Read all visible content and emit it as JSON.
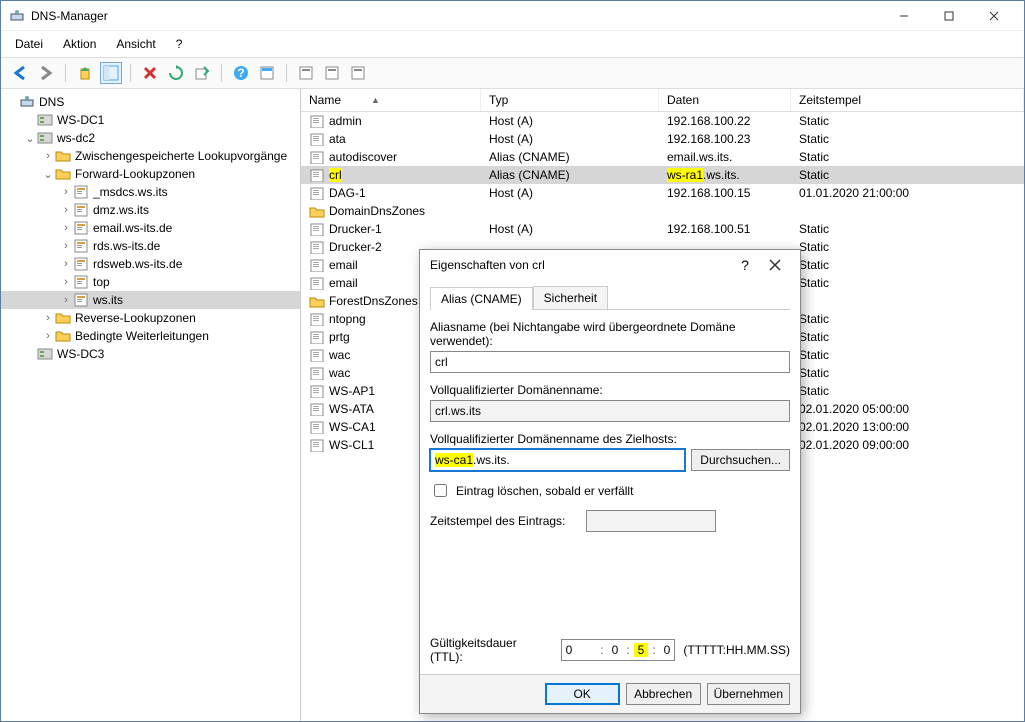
{
  "window": {
    "title": "DNS-Manager"
  },
  "menu": {
    "datei": "Datei",
    "aktion": "Aktion",
    "ansicht": "Ansicht",
    "help": "?"
  },
  "tree": {
    "root": "DNS",
    "nodes": [
      {
        "label": "WS-DC1",
        "depth": 1,
        "exp": "",
        "icon": "server"
      },
      {
        "label": "ws-dc2",
        "depth": 1,
        "exp": "v",
        "icon": "server"
      },
      {
        "label": "Zwischengespeicherte Lookupvorgänge",
        "depth": 2,
        "exp": ">",
        "icon": "folder"
      },
      {
        "label": "Forward-Lookupzonen",
        "depth": 2,
        "exp": "v",
        "icon": "folder"
      },
      {
        "label": "_msdcs.ws.its",
        "depth": 3,
        "exp": ">",
        "icon": "zone"
      },
      {
        "label": "dmz.ws.its",
        "depth": 3,
        "exp": ">",
        "icon": "zone"
      },
      {
        "label": "email.ws-its.de",
        "depth": 3,
        "exp": ">",
        "icon": "zone"
      },
      {
        "label": "rds.ws-its.de",
        "depth": 3,
        "exp": ">",
        "icon": "zone"
      },
      {
        "label": "rdsweb.ws-its.de",
        "depth": 3,
        "exp": ">",
        "icon": "zone"
      },
      {
        "label": "top",
        "depth": 3,
        "exp": ">",
        "icon": "zone"
      },
      {
        "label": "ws.its",
        "depth": 3,
        "exp": ">",
        "icon": "zone",
        "sel": true
      },
      {
        "label": "Reverse-Lookupzonen",
        "depth": 2,
        "exp": ">",
        "icon": "folder"
      },
      {
        "label": "Bedingte Weiterleitungen",
        "depth": 2,
        "exp": ">",
        "icon": "folder"
      },
      {
        "label": "WS-DC3",
        "depth": 1,
        "exp": "",
        "icon": "server"
      }
    ]
  },
  "list": {
    "headers": {
      "name": "Name",
      "typ": "Typ",
      "daten": "Daten",
      "zs": "Zeitstempel"
    },
    "rows": [
      {
        "name": "admin",
        "typ": "Host (A)",
        "daten": "192.168.100.22",
        "zs": "Static",
        "icon": "rec"
      },
      {
        "name": "ata",
        "typ": "Host (A)",
        "daten": "192.168.100.23",
        "zs": "Static",
        "icon": "rec"
      },
      {
        "name": "autodiscover",
        "typ": "Alias (CNAME)",
        "daten": "email.ws.its.",
        "zs": "Static",
        "icon": "rec"
      },
      {
        "name": "crl",
        "typ": "Alias (CNAME)",
        "daten_pre": "ws-ra1",
        "daten_post": ".ws.its.",
        "zs": "Static",
        "icon": "rec",
        "sel": true,
        "hl_name": true
      },
      {
        "name": "DAG-1",
        "typ": "Host (A)",
        "daten": "192.168.100.15",
        "zs": "01.01.2020 21:00:00",
        "icon": "rec"
      },
      {
        "name": "DomainDnsZones",
        "typ": "",
        "daten": "",
        "zs": "",
        "icon": "folder"
      },
      {
        "name": "Drucker-1",
        "typ": "Host (A)",
        "daten": "192.168.100.51",
        "zs": "Static",
        "icon": "rec"
      },
      {
        "name": "Drucker-2",
        "typ": "",
        "daten": "",
        "zs": "Static",
        "icon": "rec"
      },
      {
        "name": "email",
        "typ": "",
        "daten": "",
        "zs": "Static",
        "icon": "rec"
      },
      {
        "name": "email",
        "typ": "",
        "daten": "",
        "zs": "Static",
        "icon": "rec"
      },
      {
        "name": "ForestDnsZones",
        "typ": "",
        "daten": "",
        "zs": "",
        "icon": "folder"
      },
      {
        "name": "ntopng",
        "typ": "",
        "daten": "",
        "zs": "Static",
        "icon": "rec"
      },
      {
        "name": "prtg",
        "typ": "",
        "daten": "",
        "zs": "Static",
        "icon": "rec"
      },
      {
        "name": "wac",
        "typ": "",
        "daten": "",
        "zs": "Static",
        "icon": "rec"
      },
      {
        "name": "wac",
        "typ": "",
        "daten": "",
        "zs": "Static",
        "icon": "rec"
      },
      {
        "name": "WS-AP1",
        "typ": "",
        "daten": "",
        "zs": "Static",
        "icon": "rec"
      },
      {
        "name": "WS-ATA",
        "typ": "",
        "daten": "",
        "zs": "02.01.2020 05:00:00",
        "icon": "rec"
      },
      {
        "name": "WS-CA1",
        "typ": "",
        "daten": "",
        "zs": "02.01.2020 13:00:00",
        "icon": "rec"
      },
      {
        "name": "WS-CL1",
        "typ": "",
        "daten": "",
        "zs": "02.01.2020 09:00:00",
        "icon": "rec"
      }
    ]
  },
  "dialog": {
    "title": "Eigenschaften von crl",
    "tab_alias": "Alias (CNAME)",
    "tab_security": "Sicherheit",
    "lbl_alias": "Aliasname (bei Nichtangabe wird übergeordnete Domäne verwendet):",
    "val_alias": "crl",
    "lbl_fqdn": "Vollqualifizierter Domänenname:",
    "val_fqdn": "crl.ws.its",
    "lbl_target": "Vollqualifizierter Domänenname des Zielhosts:",
    "val_target_hl": "ws-ca1",
    "val_target_rest": ".ws.its.",
    "btn_browse": "Durchsuchen...",
    "chk_delete": "Eintrag löschen, sobald er verfällt",
    "lbl_ts": "Zeitstempel des Eintrags:",
    "val_ts": "",
    "lbl_ttl": "Gültigkeitsdauer (TTL):",
    "ttl": {
      "d": "0",
      "h": "0",
      "m": "5",
      "s": "0"
    },
    "ttl_fmt": "(TTTTT:HH.MM.SS)",
    "btn_ok": "OK",
    "btn_cancel": "Abbrechen",
    "btn_apply": "Übernehmen"
  },
  "icons": {
    "dns": "dns-icon"
  }
}
